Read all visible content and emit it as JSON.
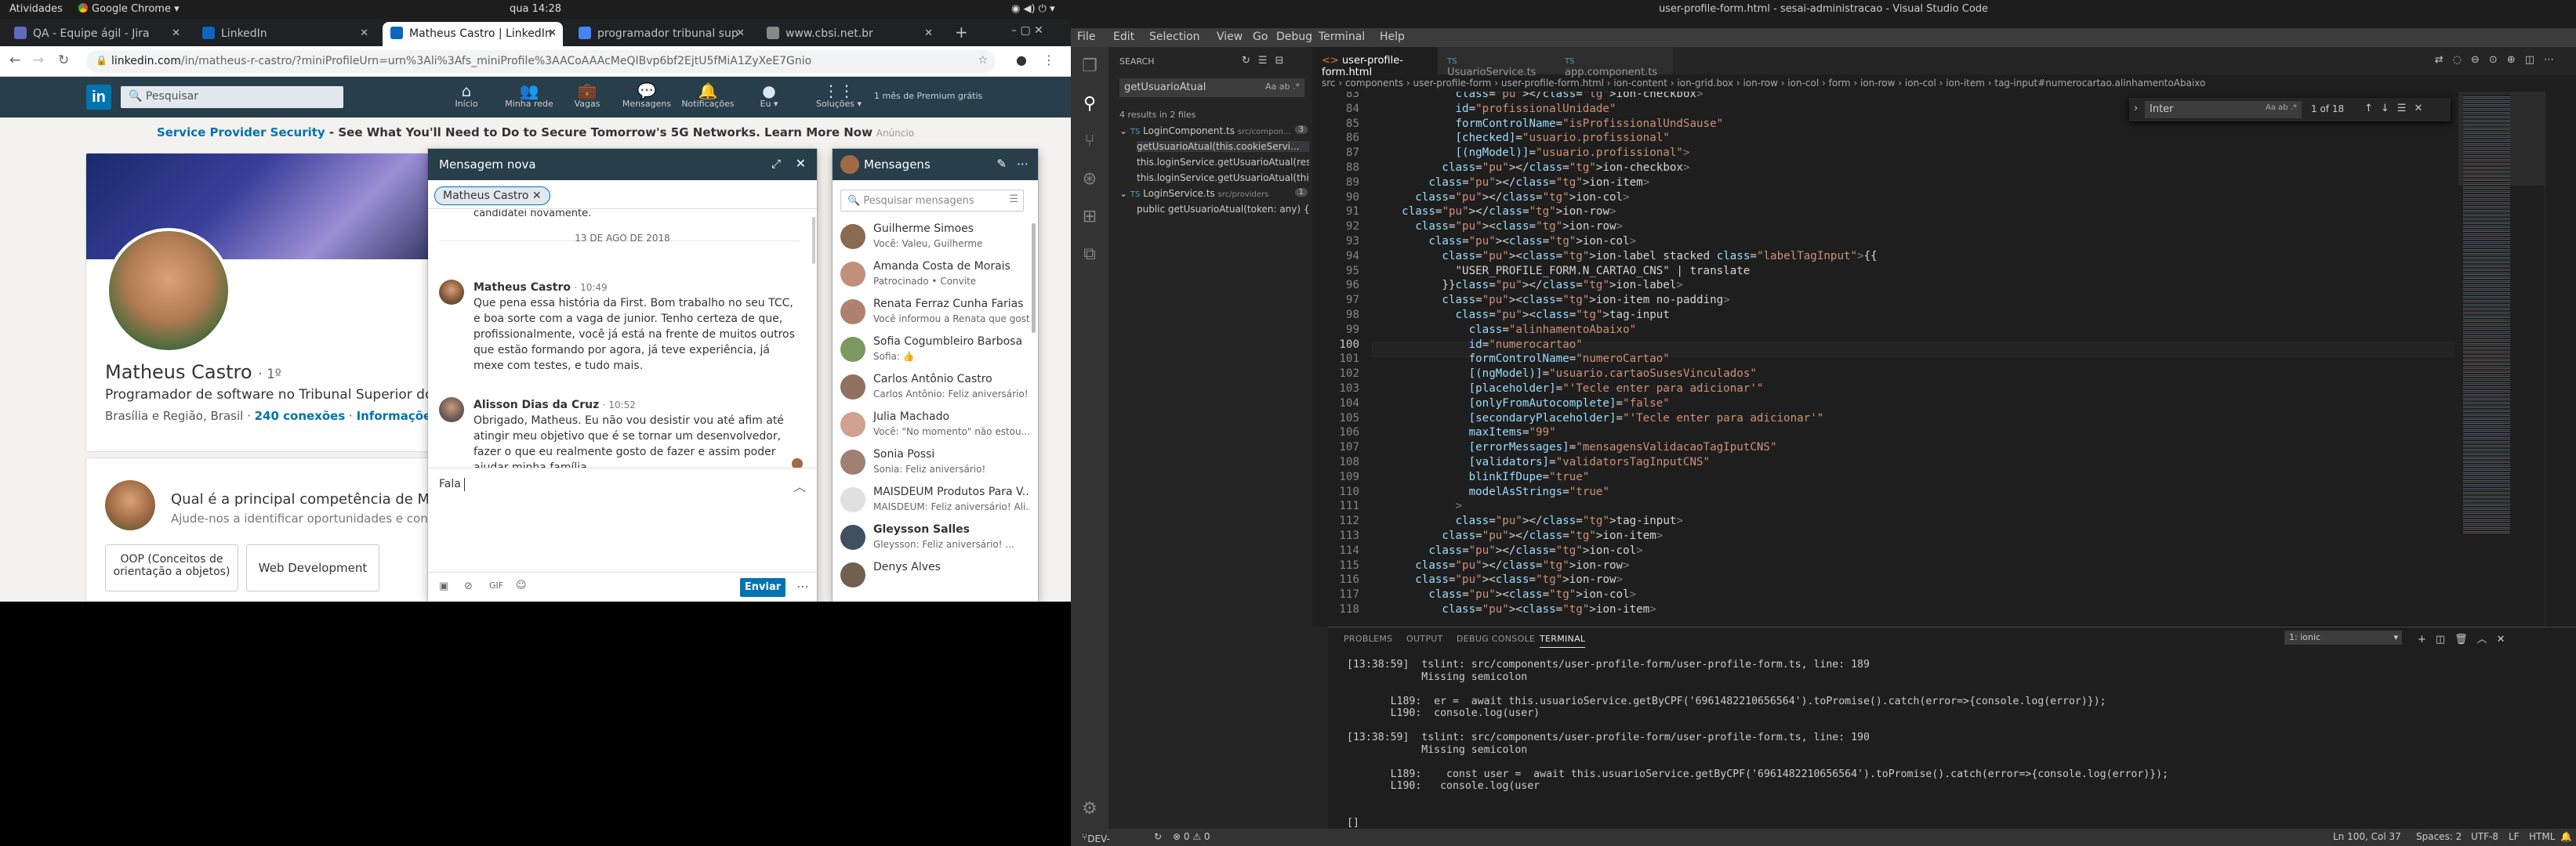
{
  "gnome": {
    "activities": "Atividades",
    "app": "Google Chrome ▾",
    "clock": "qua 14:28"
  },
  "chrome": {
    "tabs": [
      {
        "label": "QA - Equipe ágil - Jira",
        "color": "#5e6ac0"
      },
      {
        "label": "LinkedIn",
        "color": "#0a66c2"
      },
      {
        "label": "Matheus Castro | LinkedIn",
        "color": "#0a66c2"
      },
      {
        "label": "programador tribunal sup",
        "color": "#4285f4"
      },
      {
        "label": "www.cbsi.net.br",
        "color": "#888"
      }
    ],
    "url_host": "linkedin.com",
    "url_path": "/in/matheus-r-castro/?miniProfileUrn=urn%3Ali%3Afs_miniProfile%3AACoAAAcMeQIBvp6bf2EjtU5fMiA1ZyXeE7Gnio"
  },
  "linkedin": {
    "search_placeholder": "Pesquisar",
    "nav": [
      {
        "label": "Início",
        "icon": "home-icon"
      },
      {
        "label": "Minha rede",
        "icon": "network-icon"
      },
      {
        "label": "Vagas",
        "icon": "jobs-icon"
      },
      {
        "label": "Mensagens",
        "icon": "messages-icon"
      },
      {
        "label": "Notificações",
        "icon": "bell-icon"
      },
      {
        "label": "Eu ▾",
        "icon": "avatar-icon"
      },
      {
        "label": "Soluções ▾",
        "icon": "grid-icon"
      }
    ],
    "premium": "1 mês de Premium grátis",
    "ad_title": "Service Provider Security",
    "ad_text": " - See What You'll Need to Do to Secure Tomorrow's 5G Networks. Learn More Now",
    "ad_tag": "Anúncio",
    "profile": {
      "name": "Matheus Castro",
      "degree": "· 1º",
      "headline": "Programador de software no Tribunal Superior do T",
      "location": "Brasília e Região, Brasil",
      "connections": "240 conexões",
      "contact": "Informações de"
    },
    "question": "Qual é a principal competência de Mathe",
    "question_sub": "Ajude-nos a identificar oportunidades e conte",
    "skills": [
      "OOP (Conceitos de orientação a objetos)",
      "Web Development"
    ]
  },
  "new_message": {
    "title": "Mensagem nova",
    "recipient": "Matheus Castro",
    "clipped": "candidatei novamente.",
    "date": "13 DE AGO DE 2018",
    "messages": [
      {
        "name": "Matheus Castro",
        "time": "· 10:49",
        "text": "Que pena essa história da First. Bom trabalho no seu TCC, e boa sorte com a vaga de junior. Tenho certeza de que, profissionalmente, você já está na frente de muitos outros que estão formando por agora, já teve experiência, já mexe com testes, e tudo mais."
      },
      {
        "name": "Alisson Dias da Cruz",
        "time": "· 10:52",
        "text": "Obrigado, Matheus. Eu não vou desistir vou até afim até atingir meu objetivo que é se tornar um desenvolvedor, fazer o que eu realmente gosto de fazer e assim poder ajudar minha família."
      }
    ],
    "draft": "Fala",
    "send": "Enviar"
  },
  "messaging": {
    "title": "Mensagens",
    "search_placeholder": "Pesquisar mensagens",
    "conversations": [
      {
        "name": "Guilherme Simoes",
        "preview": "Você: Valeu, Guilherme"
      },
      {
        "name": "Amanda Costa de Morais",
        "preview": "Patrocinado • Convite"
      },
      {
        "name": "Renata Ferraz Cunha Farias",
        "preview": "Você informou a Renata que gost..."
      },
      {
        "name": "Sofia Cogumbleiro Barbosa",
        "preview": "Sofia: 👍"
      },
      {
        "name": "Carlos Antônio Castro",
        "preview": "Carlos Antônio: Feliz aniversário!"
      },
      {
        "name": "Julia Machado",
        "preview": "Você: \"No momento\" não estou..."
      },
      {
        "name": "Sonia Possi",
        "preview": "Sonia: Feliz aniversário!"
      },
      {
        "name": "MAISDEUM Produtos Para V...",
        "preview": "MAISDEUM: Feliz aniversário! Ali..."
      },
      {
        "name": "Gleysson Salles",
        "preview": "Gleysson: Feliz aniversário! ..."
      },
      {
        "name": "Denys Alves",
        "preview": ""
      }
    ]
  },
  "vscode": {
    "title": "user-profile-form.html - sesai-administracao - Visual Studio Code",
    "menu": [
      "File",
      "Edit",
      "Selection",
      "View",
      "Go",
      "Debug",
      "Terminal",
      "Help"
    ],
    "search": {
      "header": "SEARCH",
      "query": "getUsuarioAtual",
      "summary": "4 results in 2 files",
      "files": [
        {
          "name": "LoginComponent.ts",
          "path": "src/compon...",
          "count": "3"
        },
        {
          "name": "LoginService.ts",
          "path": "src/providers",
          "count": "1"
        }
      ],
      "results": [
        "getUsuarioAtual(this.cookieServi...",
        "this.loginService.getUsuarioAtual(res.a...",
        "this.loginService.getUsuarioAtual(this.t...",
        "public getUsuarioAtual(token: any) {"
      ]
    },
    "tabs": [
      "user-profile-form.html",
      "UsuarioService.ts",
      "app.component.ts"
    ],
    "breadcrumb": "src › components › user-profile-form › user-profile-form.html › ion-content › ion-grid.box › ion-row › ion-col › form › ion-row › ion-col › ion-item › tag-input#numerocartao.alinhamentoAbaixo",
    "find": {
      "query": "Inter",
      "count": "1 of 18"
    },
    "lines": [
      {
        "n": "83",
        "t": "            </ion-checkbox>"
      },
      {
        "n": "84",
        "t": "            id=\"profissionalUnidade\""
      },
      {
        "n": "85",
        "t": "            formControlName=\"isProfissionalUndSause\""
      },
      {
        "n": "86",
        "t": "            [checked]=\"usuario.profissional\""
      },
      {
        "n": "87",
        "t": "            [(ngModel)]=\"usuario.profissional\">"
      },
      {
        "n": "88",
        "t": "          </ion-checkbox>"
      },
      {
        "n": "89",
        "t": "        </ion-item>"
      },
      {
        "n": "90",
        "t": "      </ion-col>"
      },
      {
        "n": "91",
        "t": "    </ion-row>"
      },
      {
        "n": "92",
        "t": "      <ion-row>"
      },
      {
        "n": "93",
        "t": "        <ion-col>"
      },
      {
        "n": "94",
        "t": "          <ion-label stacked class=\"labelTagInput\">{{"
      },
      {
        "n": "95",
        "t": "            \"USER_PROFILE_FORM.N_CARTAO_CNS\" | translate"
      },
      {
        "n": "96",
        "t": "          }}</ion-label>"
      },
      {
        "n": "97",
        "t": "          <ion-item no-padding>"
      },
      {
        "n": "98",
        "t": "            <tag-input"
      },
      {
        "n": "99",
        "t": "              class=\"alinhamentoAbaixo\""
      },
      {
        "n": "100",
        "t": "              id=\"numerocartao\""
      },
      {
        "n": "101",
        "t": "              formControlName=\"numeroCartao\""
      },
      {
        "n": "102",
        "t": "              [(ngModel)]=\"usuario.cartaoSusesVinculados\""
      },
      {
        "n": "103",
        "t": "              [placeholder]=\"'Tecle enter para adicionar'\""
      },
      {
        "n": "104",
        "t": "              [onlyFromAutocomplete]=\"false\""
      },
      {
        "n": "105",
        "t": "              [secondaryPlaceholder]=\"'Tecle enter para adicionar'\""
      },
      {
        "n": "106",
        "t": "              maxItems=\"99\""
      },
      {
        "n": "107",
        "t": "              [errorMessages]=\"mensagensValidacaoTagIputCNS\""
      },
      {
        "n": "108",
        "t": "              [validators]=\"validatorsTagInputCNS\""
      },
      {
        "n": "109",
        "t": "              blinkIfDupe=\"true\""
      },
      {
        "n": "110",
        "t": "              modelAsStrings=\"true\""
      },
      {
        "n": "111",
        "t": "            >"
      },
      {
        "n": "112",
        "t": "            </tag-input>"
      },
      {
        "n": "113",
        "t": "          </ion-item>"
      },
      {
        "n": "114",
        "t": "        </ion-col>"
      },
      {
        "n": "115",
        "t": "      </ion-row>"
      },
      {
        "n": "116",
        "t": "      <ion-row>"
      },
      {
        "n": "117",
        "t": "        <ion-col>"
      },
      {
        "n": "118",
        "t": "          <ion-item>"
      }
    ],
    "panel_tabs": [
      "PROBLEMS",
      "OUTPUT",
      "DEBUG CONSOLE",
      "TERMINAL"
    ],
    "terminal_select": "1: ionic",
    "terminal": [
      "[13:38:59]  tslint: src/components/user-profile-form/user-profile-form.ts, line: 189",
      "            Missing semicolon",
      "",
      "       L189:  er =  await this.usuarioService.getByCPF('6961482210656564').toPromise().catch(error=>{console.log(error)});",
      "       L190:  console.log(user)",
      "",
      "[13:38:59]  tslint: src/components/user-profile-form/user-profile-form.ts, line: 190",
      "            Missing semicolon",
      "",
      "       L189:    const user =  await this.usuarioService.getByCPF('6961482210656564').toPromise().catch(error=>{console.log(error)});",
      "       L190:   console.log(user",
      "",
      "",
      "[]"
    ],
    "status": {
      "branch": "DEV-LAYOUT*",
      "problems": "⊗ 0 ⚠ 0",
      "pos": "Ln 100, Col 37",
      "spaces": "Spaces: 2",
      "enc": "UTF-8",
      "eol": "LF",
      "lang": "HTML"
    }
  }
}
